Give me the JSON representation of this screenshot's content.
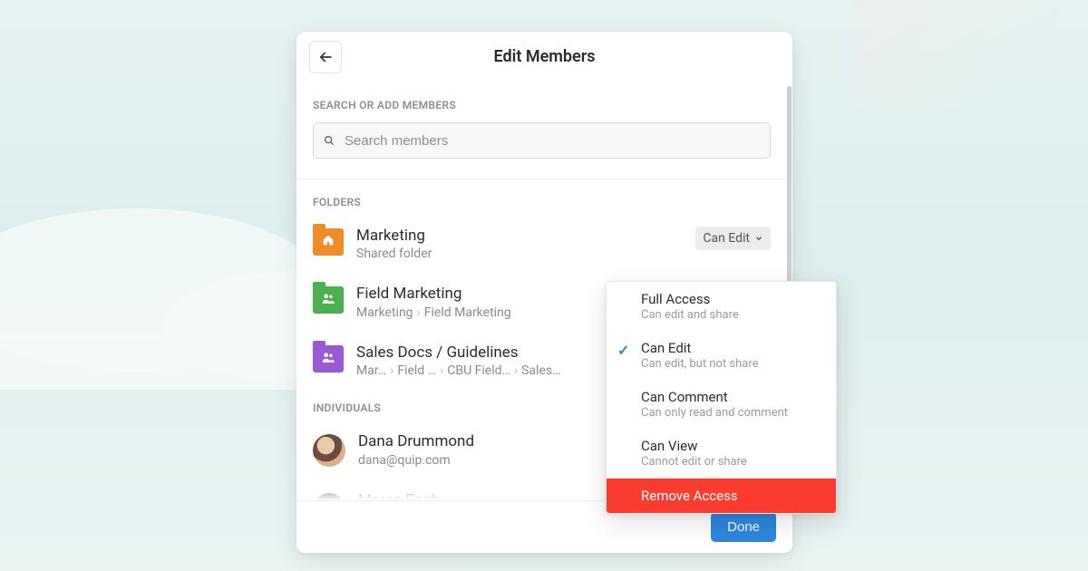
{
  "header": {
    "title": "Edit Members"
  },
  "search": {
    "label": "SEARCH OR ADD MEMBERS",
    "placeholder": "Search members"
  },
  "sections": {
    "folders_label": "FOLDERS",
    "individuals_label": "INDIVIDUALS"
  },
  "folders": [
    {
      "name": "Marketing",
      "subtitle": "Shared folder",
      "color": "orange",
      "glyph": "home",
      "permission": "Can Edit",
      "dropdown_open": true
    },
    {
      "name": "Field Marketing",
      "breadcrumb": [
        "Marketing",
        "Field Marketing"
      ],
      "color": "green",
      "glyph": "people"
    },
    {
      "name": "Sales Docs / Guidelines",
      "breadcrumb": [
        "Mar…",
        "Field …",
        "CBU Field…",
        "Sales…"
      ],
      "color": "purple",
      "glyph": "people"
    }
  ],
  "individuals": [
    {
      "name": "Dana Drummond",
      "email": "dana@quip.com"
    },
    {
      "name": "Maren Engh",
      "email": ""
    }
  ],
  "footer": {
    "done": "Done"
  },
  "dropdown": {
    "options": [
      {
        "title": "Full Access",
        "sub": "Can edit and share",
        "selected": false
      },
      {
        "title": "Can Edit",
        "sub": "Can edit, but not share",
        "selected": true
      },
      {
        "title": "Can Comment",
        "sub": "Can only read and comment",
        "selected": false
      },
      {
        "title": "Can View",
        "sub": "Cannot edit or share",
        "selected": false
      }
    ],
    "remove": "Remove Access"
  }
}
